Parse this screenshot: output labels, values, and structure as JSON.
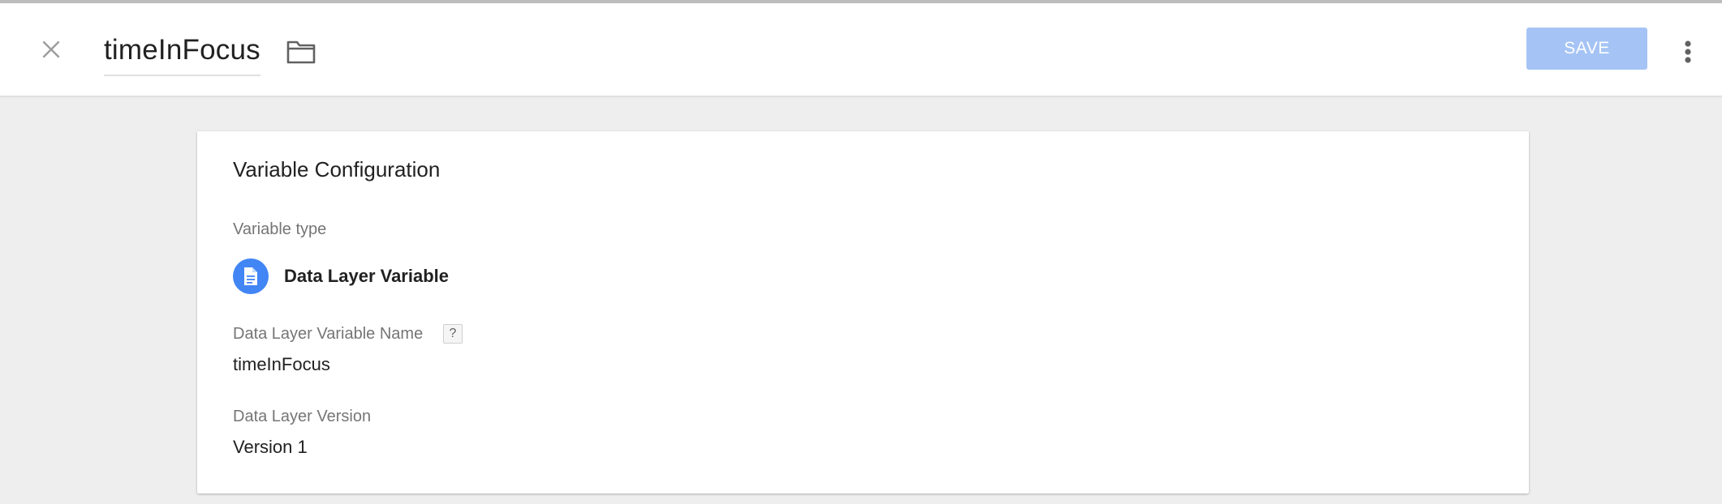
{
  "header": {
    "title": "timeInFocus",
    "save_label": "SAVE",
    "icons": {
      "close": "close-icon",
      "folder": "folder-icon",
      "more": "more-vert-icon"
    }
  },
  "colors": {
    "save_disabled": "#a5c4f5",
    "type_icon_bg": "#4285f4",
    "page_bg": "#eeeeee"
  },
  "config": {
    "title": "Variable Configuration",
    "variable_type_label": "Variable type",
    "variable_type_value": "Data Layer Variable",
    "variable_type_icon": "document-icon",
    "dlv_name_label": "Data Layer Variable Name",
    "help_glyph": "?",
    "dlv_name_value": "timeInFocus",
    "dlv_version_label": "Data Layer Version",
    "dlv_version_value": "Version 1"
  }
}
